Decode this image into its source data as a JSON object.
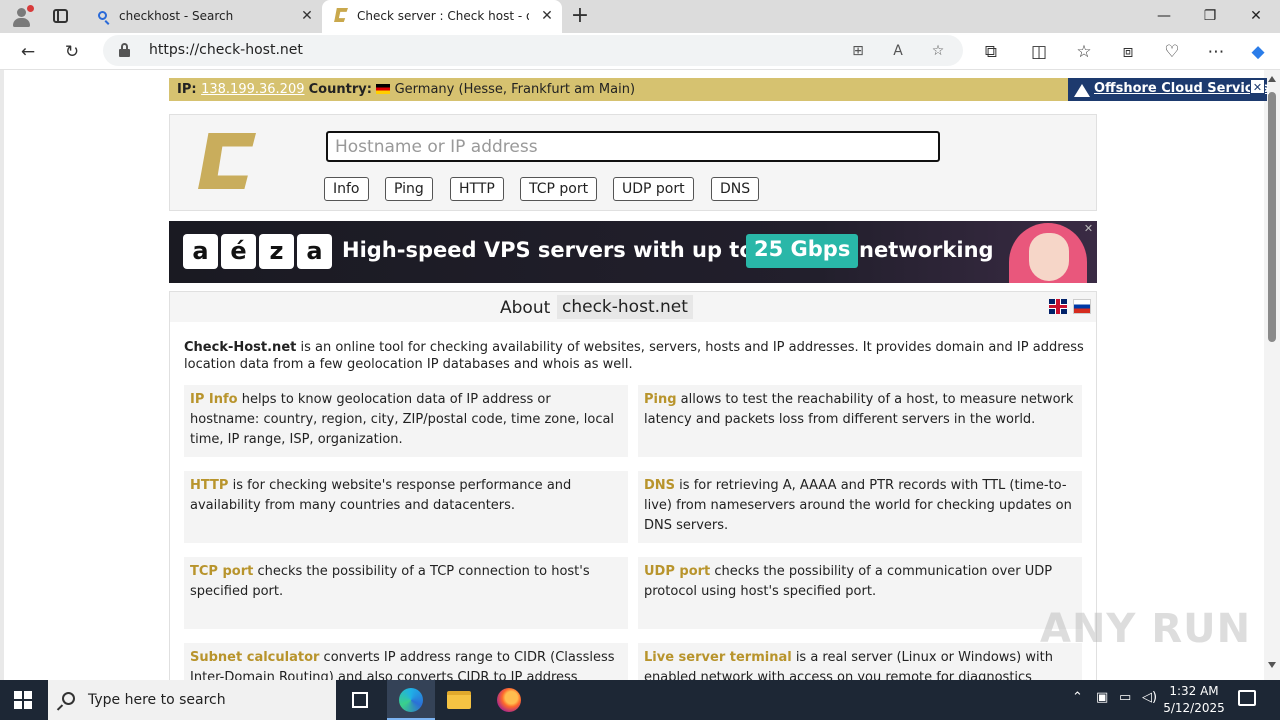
{
  "browser": {
    "tabs": [
      {
        "title": "checkhost - Search",
        "icon": "search-icon"
      },
      {
        "title": "Check server : Check host - online",
        "icon": "check-host-favicon"
      }
    ],
    "url": "https://check-host.net"
  },
  "ipbar": {
    "ip_label": "IP",
    "ip": "138.199.36.209",
    "country_label": "Country",
    "country": "Germany (Hesse, Frankfurt am Main)",
    "offshore": "Offshore Cloud Services",
    "close": "✕"
  },
  "search": {
    "placeholder": "Hostname or IP address",
    "buttons": [
      "Info",
      "Ping",
      "HTTP",
      "TCP port",
      "UDP port",
      "DNS"
    ]
  },
  "banner": {
    "letters": [
      "a",
      "é",
      "z",
      "a"
    ],
    "headline": "High-speed VPS servers with up to",
    "highlight": "25 Gbps",
    "tail": "networking",
    "close": "✕"
  },
  "about": {
    "label": "About",
    "site": "check-host.net",
    "intro_name": "Check-Host.net",
    "intro_text": " is an online tool for checking availability of websites, servers, hosts and IP addresses. It provides domain and IP address location data from a few geolocation IP databases and whois as well.",
    "cards": [
      {
        "name": "IP Info",
        "text": " helps to know geolocation data of IP address or hostname: country, region, city, ZIP/postal code, time zone, local time, IP range, ISP, organization."
      },
      {
        "name": "Ping",
        "text": " allows to test the reachability of a host, to measure network latency and packets loss from different servers in the world."
      },
      {
        "name": "HTTP",
        "text": " is for checking website's response performance and availability from many countries and datacenters."
      },
      {
        "name": "DNS",
        "text": " is for retrieving A, AAAA and PTR records with TTL (time-to-live) from nameservers around the world for checking updates on DNS servers."
      },
      {
        "name": "TCP port",
        "text": " checks the possibility of a TCP connection to host's specified port."
      },
      {
        "name": "UDP port",
        "text": " checks the possibility of a communication over UDP protocol using host's specified port."
      },
      {
        "name": "Subnet calculator",
        "text": " converts IP address range to CIDR (Classless Inter-Domain Routing) and also converts CIDR to IP address range."
      },
      {
        "name": "Live server terminal",
        "text": " is a real server (Linux or Windows) with enabled network with access on you remote for diagnostics settings."
      }
    ]
  },
  "taskbar": {
    "search_placeholder": "Type here to search",
    "time": "1:32 AM",
    "date": "5/12/2025"
  },
  "watermark": "ANY RUN",
  "colors": {
    "accent_gold": "#c9ad5c",
    "ipbar": "#d6c270",
    "offshore_blue": "#1d3a6e",
    "link_gold": "#b8942c"
  }
}
